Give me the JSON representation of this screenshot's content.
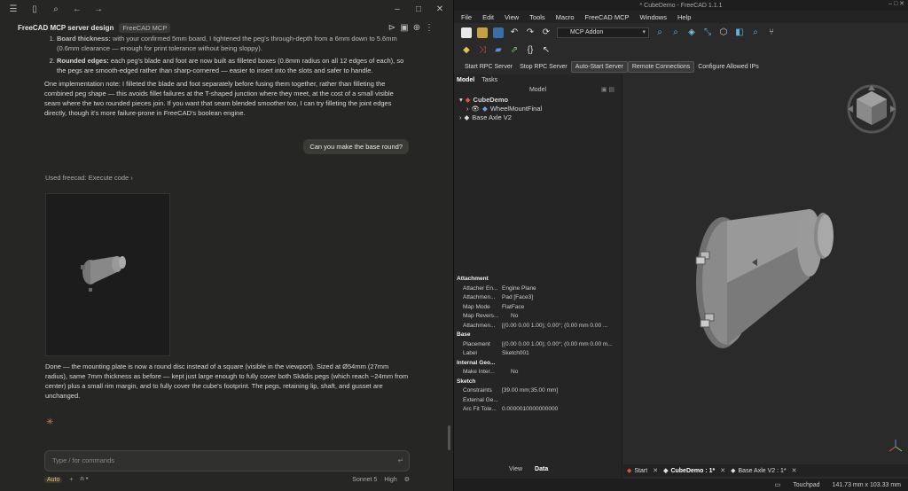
{
  "chat": {
    "title": "FreeCAD MCP server design",
    "tag": "FreeCAD MCP",
    "list": [
      "Board thickness: with your confirmed 5mm board, I tightened the peg's through-depth from a 6mm down to 5.6mm (0.6mm clearance — enough for print tolerance without being sloppy).",
      "Rounded edges: each peg's blade and foot are now built as filleted boxes (0.8mm radius on all 12 edges of each), so the pegs are smooth-edged rather than sharp-cornered — easier to insert into the slots and safer to handle."
    ],
    "list_bold": [
      "Board thickness:",
      "Rounded edges:"
    ],
    "note": "One implementation note: I filleted the blade and foot separately before fusing them together, rather than filleting the combined peg shape — this avoids fillet failures at the T-shaped junction where they meet, at the cost of a small visible seam where the two rounded pieces join. If you want that seam blended smoother too, I can try filleting the joint edges directly, though it's more failure-prone in FreeCAD's boolean engine.",
    "user_msg": "Can you make the base round?",
    "used_tool": "Used freecad: Execute code",
    "done": "Done — the mounting plate is now a round disc instead of a square (visible in the viewport). Sized at Ø54mm (27mm radius), same 7mm thickness as before — kept just large enough to fully cover both Skādis pegs (which reach ~24mm from center) plus a small rim margin, and to fully cover the cube's footprint. The pegs, retaining lip, shaft, and gusset are unchanged.",
    "placeholder": "Type / for commands",
    "mode": "Auto",
    "model": "Sonnet 5",
    "effort": "High"
  },
  "freecad": {
    "window_title": "* CubeDemo - FreeCAD 1.1.1",
    "menu": [
      "File",
      "Edit",
      "View",
      "Tools",
      "Macro",
      "FreeCAD MCP",
      "Windows",
      "Help"
    ],
    "workbench": "MCP Addon",
    "rpc_buttons": [
      "Start RPC Server",
      "Stop RPC Server",
      "Auto-Start Server",
      "Remote Connections",
      "Configure Allowed IPs"
    ],
    "panel_tabs": [
      "Model",
      "Tasks"
    ],
    "tree_header": "Model",
    "tree": [
      "CubeDemo",
      "WheelMountFinal",
      "Base Axle V2"
    ],
    "prop_groups": {
      "attachment": "Attachment",
      "base": "Base",
      "internal": "Internal Geo...",
      "sketch": "Sketch"
    },
    "props_attachment": [
      {
        "k": "Attacher En...",
        "v": "Engine Plane"
      },
      {
        "k": "Attachmen...",
        "v": "Pad [Face3]"
      },
      {
        "k": "Map Mode",
        "v": "FlatFace"
      },
      {
        "k": "Map Revers...",
        "v": "No"
      },
      {
        "k": "Attachmen...",
        "v": "[(0.00 0.00 1.00); 0.00°; (0.00 mm  0.00 ..."
      }
    ],
    "props_base": [
      {
        "k": "Placement",
        "v": "[(0.00 0.00 1.00); 0.00°; (0.00 mm  0.00 m..."
      },
      {
        "k": "Label",
        "v": "Sketch001"
      }
    ],
    "props_internal": [
      {
        "k": "Make Inter...",
        "v": "No"
      }
    ],
    "props_sketch": [
      {
        "k": "Constraints",
        "v": "[39.00 mm;35.00 mm]"
      },
      {
        "k": "External Ge...",
        "v": ""
      },
      {
        "k": "Arc Fit Tole...",
        "v": "0.0000010000000000"
      }
    ],
    "view_data": [
      "View",
      "Data"
    ],
    "doc_tabs": [
      "Start",
      "CubeDemo : 1*",
      "Base Axle V2 : 1*"
    ],
    "nav_style": "Touchpad",
    "dimensions": "141.73 mm x 103.33 mm"
  }
}
